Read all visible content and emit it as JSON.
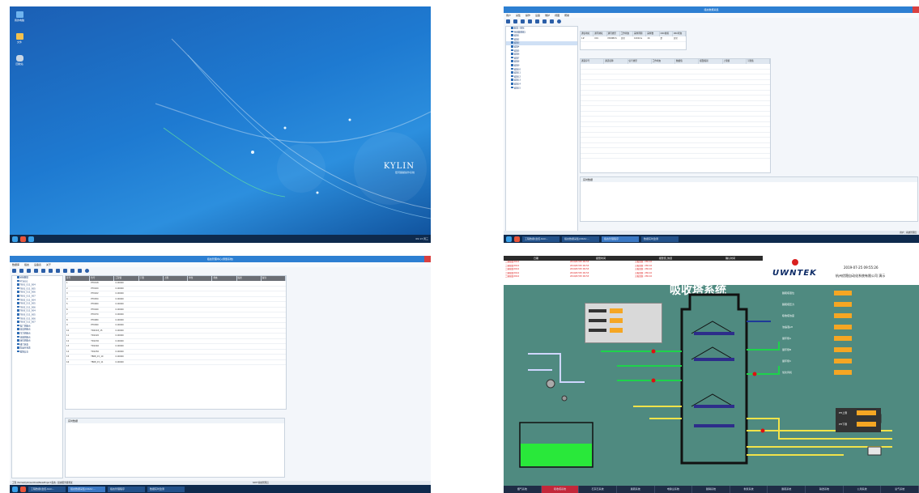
{
  "panel1": {
    "desktop_icons": [
      {
        "label": "我的电脑",
        "color": "#6fb4ef"
      },
      {
        "label": "文件",
        "color": "#f2c14e"
      },
      {
        "label": "回收站",
        "color": "#c9d6e4"
      }
    ],
    "logo_text": "KYLIN",
    "logo_sub": "银河麒麟操作系统",
    "taskbar_clock": "09:13 周三"
  },
  "panel2": {
    "window_title": "组态数据采集",
    "menus": [
      "用户",
      "采集",
      "操作",
      "设备",
      "维护",
      "视图",
      "帮助"
    ],
    "tree_items": [
      "组态一键化",
      "传感器数据1",
      "设备1",
      "设备2",
      "设备3",
      "设备4",
      "设备5",
      "设备6",
      "设备7",
      "设备8",
      "设备9",
      "设备10",
      "设备11",
      "设备12",
      "设备13",
      "设备14",
      "设备15"
    ],
    "top_table_headers": [
      "通信地址",
      "通讯地址",
      "通讯类型",
      "工作状态",
      "采样周期",
      "采样数",
      "CRC校验",
      "CRC状态"
    ],
    "top_table_rows": [
      [
        "1#",
        "001",
        "MODBUS",
        "正常",
        "1000ms",
        "16",
        "是",
        "正常"
      ]
    ],
    "main_table_headers": [
      "通道序号",
      "通道名称",
      "信号类型",
      "工作状态",
      "数据值",
      "报警级别",
      "上限值",
      "下限值"
    ],
    "main_table_row_count": 18,
    "detail_title": "实时数据",
    "status_text": "用户：系统管理员",
    "taskbar_tasks": [
      "工程数据(监控-RAC…",
      "组态数据采集(ORAC…",
      "组态管理程序",
      "数据实时监测"
    ]
  },
  "panel3": {
    "window_title": "组态管理中心(测量系统)",
    "menus": [
      "数据库",
      "组态",
      "设备表",
      "关于"
    ],
    "tree_items": [
      "系统数据",
      "PT0001",
      "TB01_S11_S04",
      "TB01_S11_S05",
      "TB01_S11_S06",
      "TB01_S11_S07",
      "TB02_S11_S04",
      "TB02_S11_S05",
      "TB02_S11_S06",
      "TB03_S11_S04",
      "TB03_S11_S05",
      "TB03_S11_S06",
      "TB03_S11_S07",
      "电厂测量点",
      "温度测量点",
      "压力测量点",
      "流量测量点",
      "液位测量点",
      "阀门状态",
      "泵运行状态",
      "报警信息"
    ],
    "table_headers": [
      "序号",
      "位号",
      "工程值",
      "下限",
      "上限",
      "单位",
      "状态",
      "描述",
      "备注"
    ],
    "table_rows": [
      [
        "1",
        "PT0018",
        "0.00000"
      ],
      [
        "2",
        "PT0020",
        "0.00000"
      ],
      [
        "3",
        "PT0022",
        "0.00000"
      ],
      [
        "4",
        "PT0050",
        "0.00000"
      ],
      [
        "5",
        "PT0060",
        "0.00000"
      ],
      [
        "6",
        "PT0040",
        "0.00000"
      ],
      [
        "7",
        "PT0070",
        "0.00000"
      ],
      [
        "8",
        "PT0080",
        "0.00000"
      ],
      [
        "9",
        "PT0090",
        "0.00000"
      ],
      [
        "10",
        "TD2018_15",
        "0.00000"
      ],
      [
        "11",
        "TD1020",
        "0.00000"
      ],
      [
        "12",
        "TD1030",
        "0.00000"
      ],
      [
        "13",
        "TD1040",
        "0.00000"
      ],
      [
        "14",
        "TD1050",
        "0.00000"
      ],
      [
        "15",
        "TB08_15_10",
        "0.00000"
      ],
      [
        "16",
        "TB08_15_11",
        "0.00000"
      ]
    ],
    "detail_title": "实时数据",
    "status_path": "工程 /home/kylin/sentinel/NewProject 组态 - 组态服务器测试",
    "status_right": "SNYT系统管理员"
  },
  "panel4": {
    "alarm_headers": [
      "日期",
      "报警时间",
      "报警值_恢复",
      "确认时间"
    ],
    "alarm_rows": [
      [
        "二级报警2014",
        "2019/07/25 09:53",
        "无报警值: 236.10",
        ""
      ],
      [
        "二级报警2014",
        "2019/07/25 09:53",
        "无报警值: 236.10",
        ""
      ],
      [
        "二级报警2014",
        "2019/07/25 09:53",
        "无报警值: 236.10",
        ""
      ],
      [
        "二级报警2014",
        "2019/07/25 09:53",
        "无报警值: 236.10",
        ""
      ],
      [
        "二级报警2014",
        "2019/07/25 09:53",
        "无报警值: 236.10",
        ""
      ]
    ],
    "title": "吸收塔系统",
    "brand": "UWNTEK",
    "datetime": "2019-07-25 09:55:26",
    "company": "杭州优稳自动化系统有限公司 演示",
    "right_labels": [
      "脱硫塔液位",
      "脱硫塔压力",
      "吸收塔浓度",
      "浓缩液pH",
      "循环泵A",
      "循环泵B",
      "循环泵C",
      "氧化风机"
    ],
    "ph_labels": [
      "PH上限",
      "PH下限"
    ],
    "tabs": [
      "烟气系统",
      "吸收塔系统",
      "石灰石系统",
      "脱硫系统",
      "电除尘系统",
      "脱硝系统",
      "制浆系统",
      "脱硫系统",
      "输送系统",
      "公用系统",
      "氨气系统"
    ],
    "active_tab": 1
  }
}
